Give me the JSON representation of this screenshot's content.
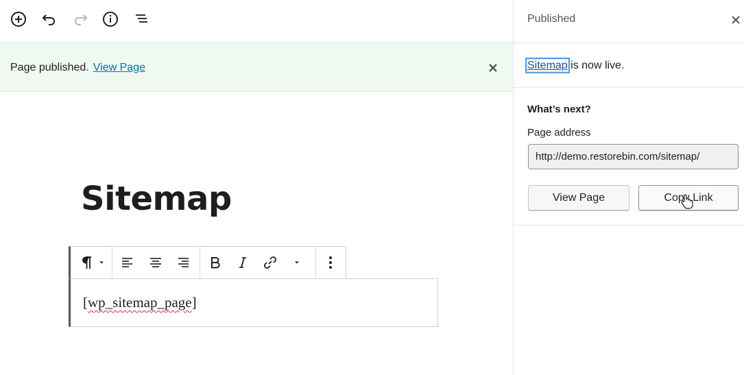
{
  "toolbar": {
    "icons": [
      "add-block-icon",
      "undo-icon",
      "redo-icon",
      "info-icon",
      "outline-icon"
    ]
  },
  "notice": {
    "message": "Page published.",
    "link_label": "View Page"
  },
  "editor": {
    "page_title": "Sitemap",
    "block": {
      "shortcode_open": "[",
      "shortcode_word": "wp_sitemap_page",
      "shortcode_close": "]"
    }
  },
  "sidebar": {
    "title": "Published",
    "live": {
      "link_label": "Sitemap",
      "suffix": " is now live."
    },
    "next_heading": "What’s next?",
    "address_label": "Page address",
    "address_value": "http://demo.restorebin.com/sitemap/",
    "view_page_label": "View Page",
    "copy_link_label": "Copy Link"
  },
  "colors": {
    "accent_link": "#0073aa",
    "notice_bg": "#eff9f1",
    "block_border": "#50575e"
  }
}
